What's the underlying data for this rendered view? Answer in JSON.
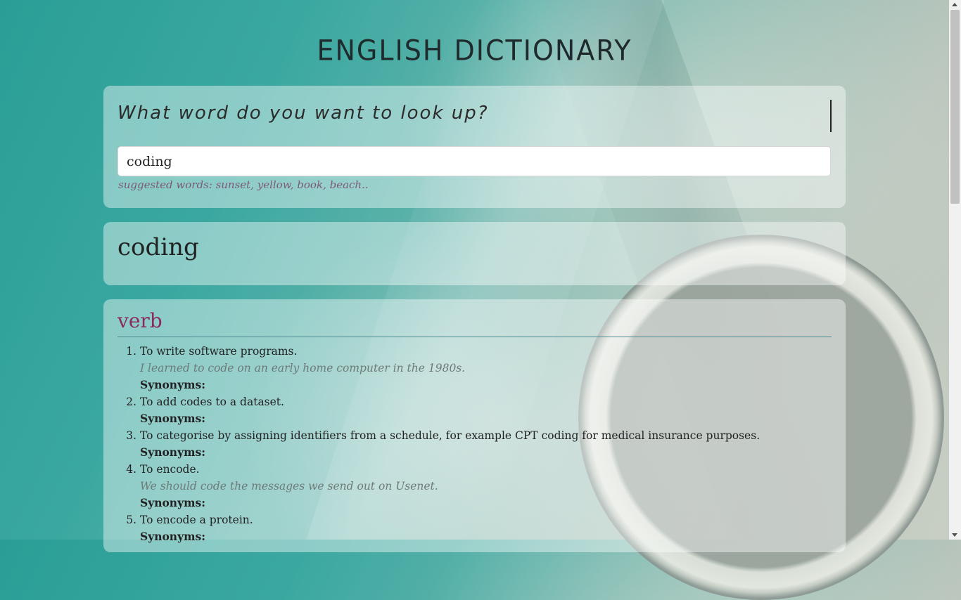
{
  "app": {
    "title": "ENGLISH DICTIONARY"
  },
  "search": {
    "prompt": "What word do you want to look up?",
    "value": "coding",
    "suggestions": "suggested words: sunset, yellow, book, beach.."
  },
  "result": {
    "word": "coding"
  },
  "meaning": {
    "part_of_speech": "verb",
    "synonyms_label": "Synonyms:",
    "definitions": [
      {
        "text": "To write software programs.",
        "example": "I learned to code on an early home computer in the 1980s."
      },
      {
        "text": "To add codes to a dataset.",
        "example": ""
      },
      {
        "text": "To categorise by assigning identifiers from a schedule, for example CPT coding for medical insurance purposes.",
        "example": ""
      },
      {
        "text": "To encode.",
        "example": "We should code the messages we send out on Usenet."
      },
      {
        "text": "To encode a protein.",
        "example": ""
      }
    ]
  },
  "colors": {
    "accent": "#8b2a5e",
    "rule": "#4f8a8e",
    "example": "#6e7a78",
    "suggestion": "#7b5a78"
  }
}
